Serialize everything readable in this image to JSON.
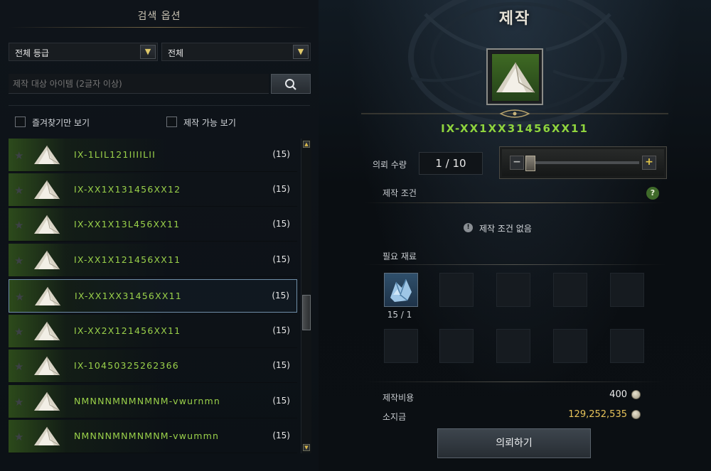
{
  "left_panel": {
    "title": "검색 옵션",
    "grade_dropdown": "전체 등급",
    "category_dropdown": "전체",
    "search_placeholder": "제작 대상 아이템 (2글자 이상)",
    "filter_favorites": "즐겨찾기만 보기",
    "filter_craftable": "제작 가능 보기",
    "items": [
      {
        "name": "IX-1LIL121IIIILII",
        "count": "(15)"
      },
      {
        "name": "IX-XX1X131456XX12",
        "count": "(15)"
      },
      {
        "name": "IX-XX1X13L456XX11",
        "count": "(15)"
      },
      {
        "name": "IX-XX1X121456XX11",
        "count": "(15)"
      },
      {
        "name": "IX-XX1XX31456XX11",
        "count": "(15)"
      },
      {
        "name": "IX-XX2X121456XX11",
        "count": "(15)"
      },
      {
        "name": "IX-10450325262366",
        "count": "(15)"
      },
      {
        "name": "NMNNNMNMNMNM-vwurnmn",
        "count": "(15)"
      },
      {
        "name": "NMNNNMNMNMNM-vwummn",
        "count": "(15)"
      }
    ],
    "selected_index": 4
  },
  "right_panel": {
    "title": "제작",
    "item_name": "IX-XX1XX31456XX11",
    "qty_label": "의뢰 수량",
    "qty_value": "1 / 10",
    "slider_minus": "−",
    "slider_plus": "+",
    "condition_label": "제작 조건",
    "help_symbol": "?",
    "condition_none": "제작 조건 없음",
    "materials_label": "필요 재료",
    "material_count": "15 / 1",
    "cost_label": "제작비용",
    "cost_value": "400",
    "owned_label": "소지금",
    "owned_value": "129,252,535",
    "request_button": "의뢰하기"
  },
  "colors": {
    "item_name_green": "#9ad14a",
    "gold": "#e7c35a"
  }
}
